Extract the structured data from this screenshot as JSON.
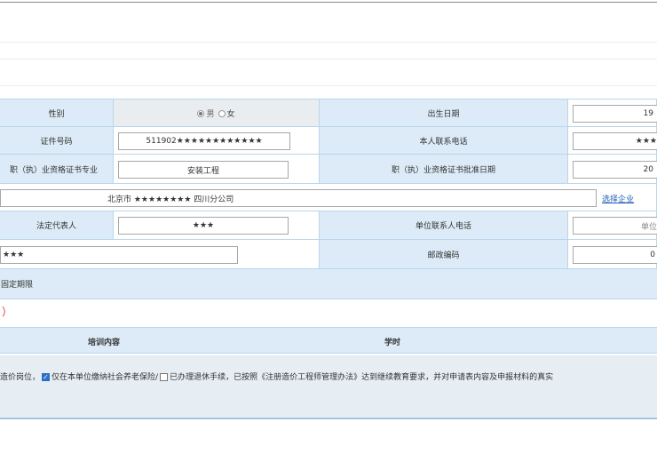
{
  "form": {
    "gender": {
      "label": "性别",
      "male": "男",
      "female": "女",
      "selected": "male"
    },
    "birth_date": {
      "label": "出生日期",
      "value": "19"
    },
    "id_number": {
      "label": "证件号码",
      "value": "511902★★★★★★★★★★★★"
    },
    "phone": {
      "label": "本人联系电话",
      "value": "★★★"
    },
    "cert_major": {
      "label": "职（执）业资格证书专业",
      "value": "安装工程"
    },
    "cert_date": {
      "label": "职（执）业资格证书批准日期",
      "value": "20"
    },
    "company": {
      "value": "北京市 ★★★★★★★★ 四川分公司",
      "select_link": "选择企业"
    },
    "legal_rep": {
      "label": "法定代表人",
      "value": "★★★"
    },
    "unit_phone": {
      "label": "单位联系人电话",
      "placeholder": "单位"
    },
    "address": {
      "value": "★★★"
    },
    "postcode": {
      "label": "邮政编码",
      "value": "0"
    },
    "fixed_term": {
      "text": "固定期限"
    }
  },
  "section": {
    "fragment": "）"
  },
  "training": {
    "col_content": "培训内容",
    "col_hours": "学时"
  },
  "declaration": {
    "part1": "造价岗位，",
    "part2": "仅在本单位缴纳社会养老保险/",
    "part3": "已办理退休手续，已按照《注册造价工程师管理办法》达到继续教育要求，并对申请表内容及申报材料的真实"
  }
}
